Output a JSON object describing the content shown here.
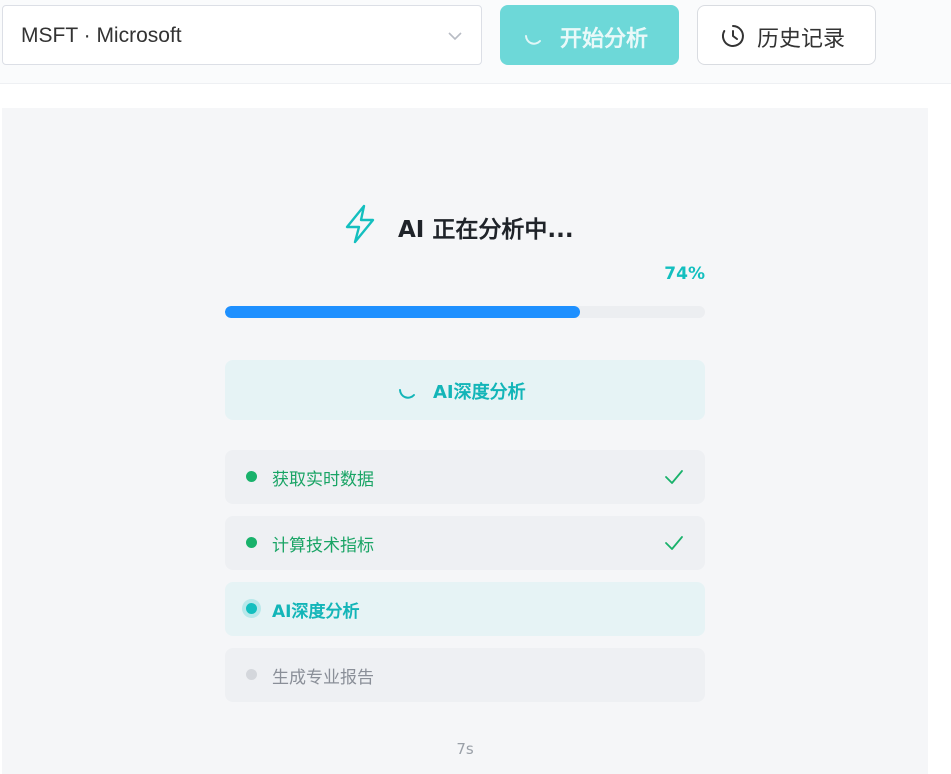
{
  "toolbar": {
    "stock_select": {
      "value": "MSFT · Microsoft",
      "chevron_icon": "chevron-down-icon"
    },
    "start_button": {
      "label": "开始分析",
      "state": "loading",
      "color": "#6dd8d8"
    },
    "history_button": {
      "label": "历史记录",
      "icon": "clock-icon"
    }
  },
  "analysis": {
    "icon": "lightning-icon",
    "title": "AI 正在分析中...",
    "progress": {
      "percent_label": "74%",
      "value": 0.74,
      "color": "#1e90ff"
    },
    "current_step": {
      "label": "AI深度分析",
      "icon": "spinner-icon"
    },
    "steps": [
      {
        "label": "获取实时数据",
        "status": "done"
      },
      {
        "label": "计算技术指标",
        "status": "done"
      },
      {
        "label": "AI深度分析",
        "status": "active"
      },
      {
        "label": "生成专业报告",
        "status": "pending"
      }
    ],
    "elapsed": "7s"
  },
  "colors": {
    "accent": "#13bfbf",
    "success": "#19b26b",
    "progress": "#1e90ff"
  }
}
